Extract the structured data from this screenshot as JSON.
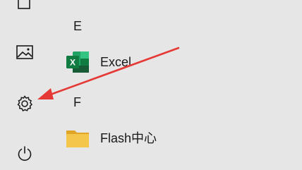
{
  "rail": {
    "icons": [
      "documents-icon",
      "pictures-icon",
      "settings-icon",
      "power-icon"
    ]
  },
  "groups": [
    {
      "letter": "E",
      "apps": [
        {
          "label": "Excel",
          "icon": "excel-icon",
          "color": "#107c41"
        }
      ]
    },
    {
      "letter": "F",
      "apps": [
        {
          "label": "Flash中心",
          "icon": "folder-icon",
          "color": "#f4c64b"
        }
      ]
    }
  ],
  "annotation": {
    "color": "#e53935",
    "icon": "red-arrow-annotation"
  }
}
